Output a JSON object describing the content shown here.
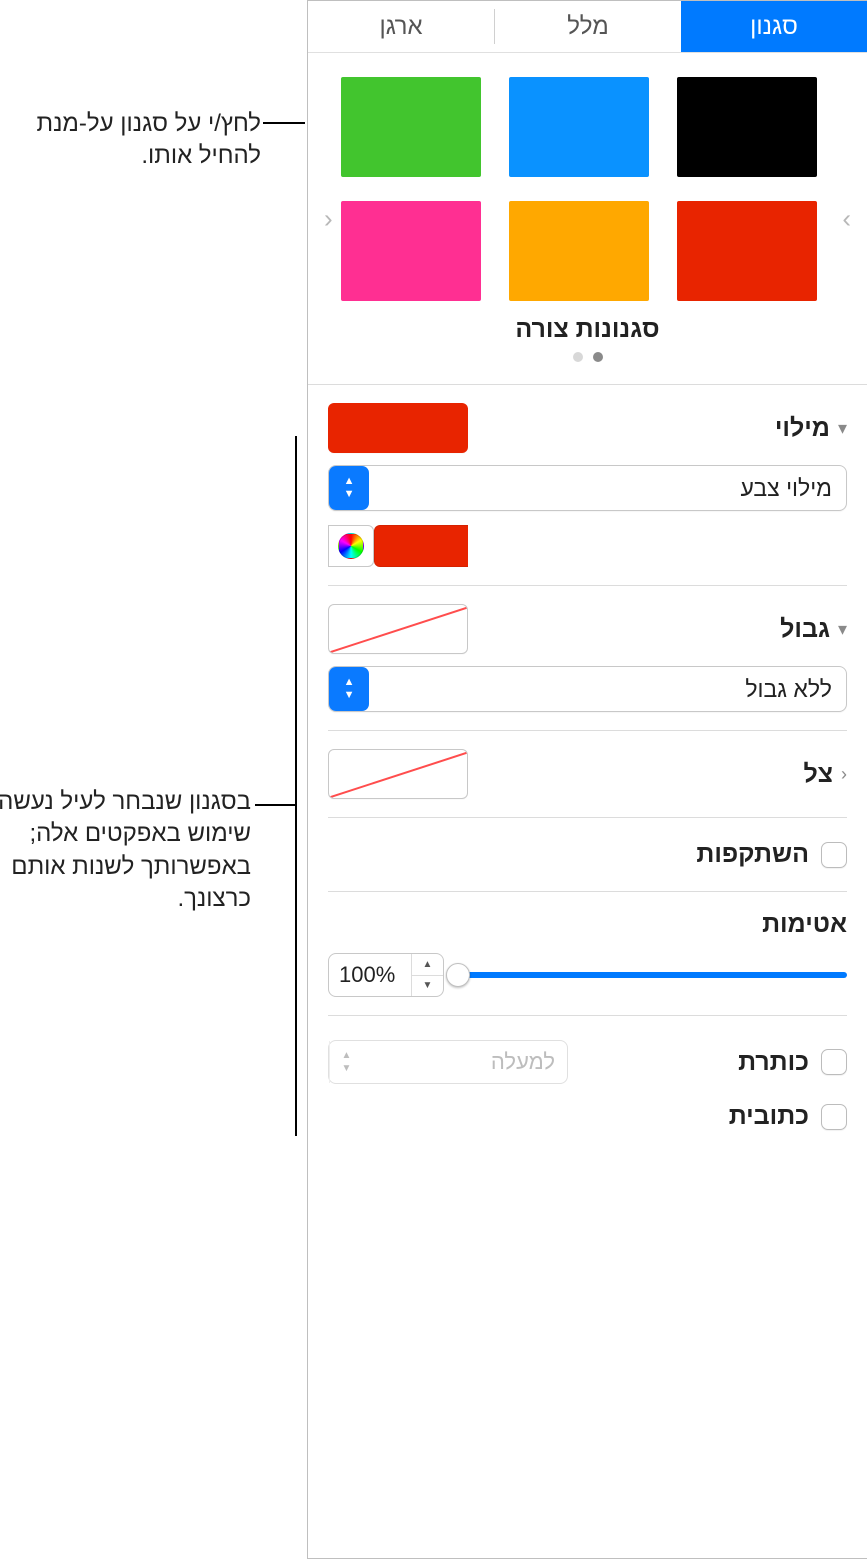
{
  "tabs": {
    "style": "סגנון",
    "text": "מלל",
    "arrange": "ארגן"
  },
  "styles_label": "סגנונות צורה",
  "swatches": [
    "#000000",
    "#0a92ff",
    "#42c52e",
    "#e82400",
    "#ffa800",
    "#ff2f92"
  ],
  "fill": {
    "title": "מילוי",
    "type": "מילוי צבע",
    "color": "#e82400"
  },
  "border": {
    "title": "גבול",
    "type": "ללא גבול"
  },
  "shadow": {
    "title": "צל"
  },
  "reflection": {
    "label": "השתקפות"
  },
  "opacity": {
    "label": "אטימות",
    "value": "100%"
  },
  "title_section": {
    "title": "כותרת",
    "caption": "כתובית",
    "above": "למעלה"
  },
  "callouts": {
    "c1": "לחץ/י על סגנון על-מנת להחיל אותו.",
    "c2": "בסגנון שנבחר לעיל נעשה שימוש באפקטים אלה; באפשרותך לשנות אותם כרצונך."
  }
}
